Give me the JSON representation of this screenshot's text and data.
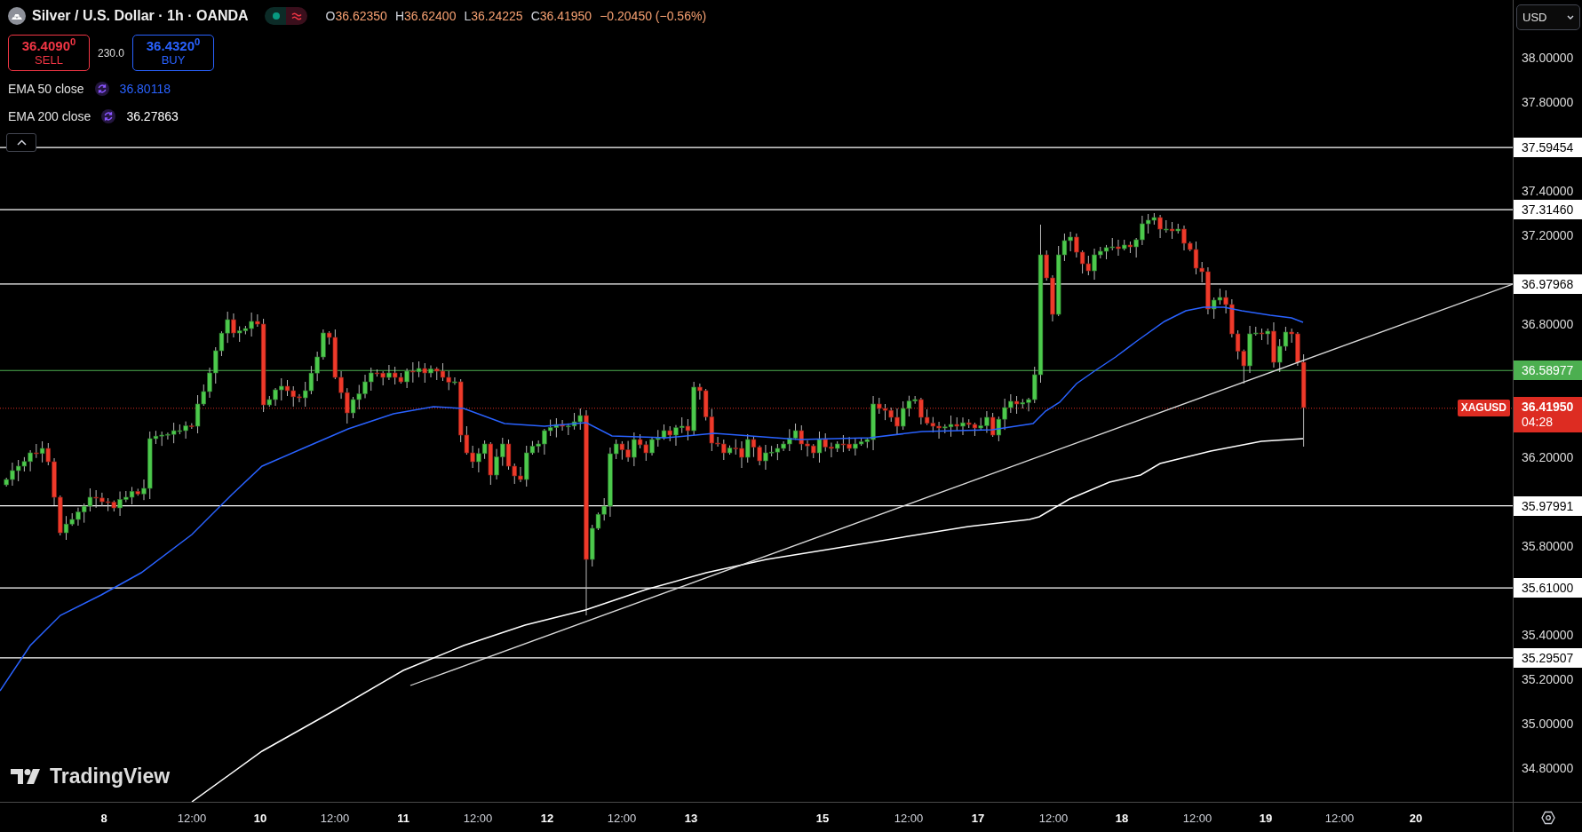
{
  "header": {
    "title": "Silver / U.S. Dollar · 1h · OANDA",
    "ohlc": [
      {
        "label": "O",
        "value": "36.62350"
      },
      {
        "label": "H",
        "value": "36.62400"
      },
      {
        "label": "L",
        "value": "36.24225"
      },
      {
        "label": "C",
        "value": "36.41950"
      }
    ],
    "change": "−0.20450 (−0.56%)"
  },
  "trade": {
    "sell": {
      "price": "36.4090$^{0}$",
      "label": "SELL"
    },
    "spread": "230.0",
    "buy": {
      "price": "36.4320$^{0}$",
      "label": "BUY"
    }
  },
  "indicators": [
    {
      "name": "EMA 50 close",
      "value": "36.80118",
      "color": "#2962ff"
    },
    {
      "name": "EMA 200 close",
      "value": "36.27863",
      "color": "#ffffff"
    }
  ],
  "logo": {
    "text": "TradingView"
  },
  "currency_menu": {
    "value": "USD"
  },
  "price_axis": {
    "ticks": [
      "38.00000",
      "37.80000",
      "37.40000",
      "37.20000",
      "36.80000",
      "36.20000",
      "35.80000",
      "35.40000",
      "35.20000",
      "35.00000",
      "34.80000"
    ],
    "levels": [
      {
        "value": "37.59454",
        "color": "#ffffff"
      },
      {
        "value": "37.31460",
        "color": "#ffffff"
      },
      {
        "value": "36.97968",
        "color": "#ffffff"
      },
      {
        "value": "36.58977",
        "color": "#4caf50"
      },
      {
        "value": "35.97991",
        "color": "#ffffff"
      },
      {
        "value": "35.61000",
        "color": "#ffffff"
      },
      {
        "value": "35.29507",
        "color": "#ffffff"
      }
    ],
    "last_price": {
      "symbol": "XAGUSD",
      "value": "36.41950",
      "countdown": "04:28"
    }
  },
  "time_axis": {
    "labels": [
      {
        "text": "8",
        "kind": "day"
      },
      {
        "text": "12:00",
        "kind": "time"
      },
      {
        "text": "10",
        "kind": "day"
      },
      {
        "text": "12:00",
        "kind": "time"
      },
      {
        "text": "11",
        "kind": "day"
      },
      {
        "text": "12:00",
        "kind": "time"
      },
      {
        "text": "12",
        "kind": "day"
      },
      {
        "text": "12:00",
        "kind": "time"
      },
      {
        "text": "13",
        "kind": "day"
      },
      {
        "text": "15",
        "kind": "day"
      },
      {
        "text": "12:00",
        "kind": "time"
      },
      {
        "text": "17",
        "kind": "day"
      },
      {
        "text": "12:00",
        "kind": "time"
      },
      {
        "text": "18",
        "kind": "day"
      },
      {
        "text": "12:00",
        "kind": "time"
      },
      {
        "text": "19",
        "kind": "day"
      },
      {
        "text": "12:00",
        "kind": "time"
      },
      {
        "text": "20",
        "kind": "day"
      }
    ]
  }
}
